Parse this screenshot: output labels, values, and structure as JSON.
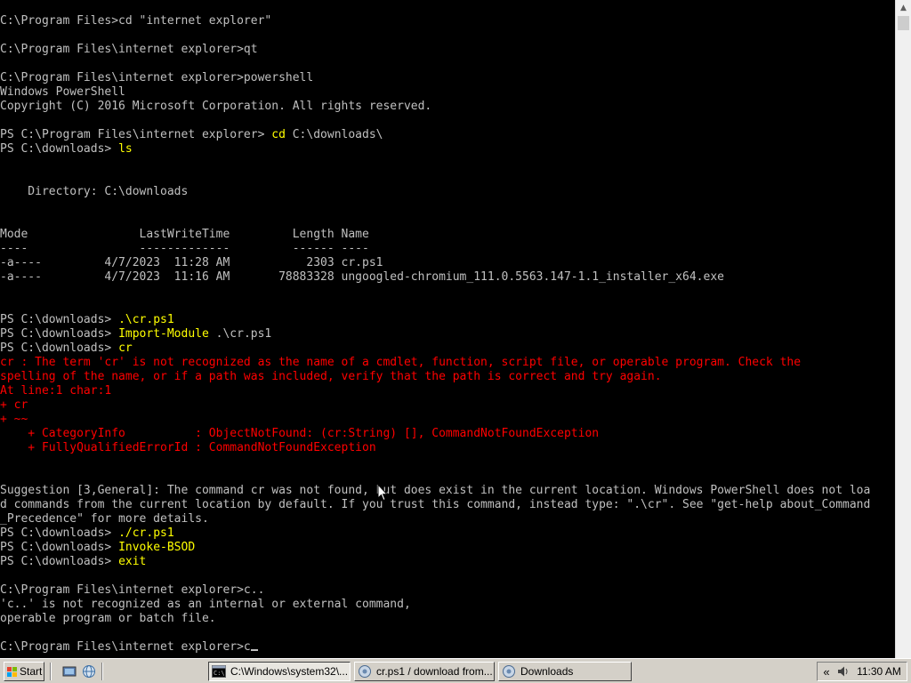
{
  "console": {
    "lines": [
      [
        {
          "t": "C:\\Program Files>cd \"internet explorer\""
        }
      ],
      [],
      [
        {
          "t": "C:\\Program Files\\internet explorer>qt"
        }
      ],
      [],
      [
        {
          "t": "C:\\Program Files\\internet explorer>powershell"
        }
      ],
      [
        {
          "t": "Windows PowerShell"
        }
      ],
      [
        {
          "t": "Copyright (C) 2016 Microsoft Corporation. All rights reserved."
        }
      ],
      [],
      [
        {
          "t": "PS C:\\Program Files\\internet explorer> "
        },
        {
          "t": "cd",
          "c": "y"
        },
        {
          "t": " C:\\downloads\\"
        }
      ],
      [
        {
          "t": "PS C:\\downloads> "
        },
        {
          "t": "ls",
          "c": "y"
        }
      ],
      [],
      [],
      [
        {
          "t": "    Directory: C:\\downloads"
        }
      ],
      [],
      [],
      [
        {
          "t": "Mode                LastWriteTime         Length Name"
        }
      ],
      [
        {
          "t": "----                -------------         ------ ----"
        }
      ],
      [
        {
          "t": "-a----         4/7/2023  11:28 AM           2303 cr.ps1"
        }
      ],
      [
        {
          "t": "-a----         4/7/2023  11:16 AM       78883328 ungoogled-chromium_111.0.5563.147-1.1_installer_x64.exe"
        }
      ],
      [],
      [],
      [
        {
          "t": "PS C:\\downloads> "
        },
        {
          "t": ".\\cr.ps1",
          "c": "y"
        }
      ],
      [
        {
          "t": "PS C:\\downloads> "
        },
        {
          "t": "Import-Module",
          "c": "y"
        },
        {
          "t": " .\\cr.ps1"
        }
      ],
      [
        {
          "t": "PS C:\\downloads> "
        },
        {
          "t": "cr",
          "c": "y"
        }
      ],
      [
        {
          "t": "cr : The term 'cr' is not recognized as the name of a cmdlet, function, script file, or operable program. Check the",
          "c": "r"
        }
      ],
      [
        {
          "t": "spelling of the name, or if a path was included, verify that the path is correct and try again.",
          "c": "r"
        }
      ],
      [
        {
          "t": "At line:1 char:1",
          "c": "r"
        }
      ],
      [
        {
          "t": "+ cr",
          "c": "r"
        }
      ],
      [
        {
          "t": "+ ~~",
          "c": "r"
        }
      ],
      [
        {
          "t": "    + CategoryInfo          : ObjectNotFound: (cr:String) [], CommandNotFoundException",
          "c": "r"
        }
      ],
      [
        {
          "t": "    + FullyQualifiedErrorId : CommandNotFoundException",
          "c": "r"
        }
      ],
      [],
      [],
      [
        {
          "t": "Suggestion [3,General]: The command cr was not found, but does exist in the current location. Windows PowerShell does not loa"
        }
      ],
      [
        {
          "t": "d commands from the current location by default. If you trust this command, instead type: \".\\cr\". See \"get-help about_Command"
        }
      ],
      [
        {
          "t": "_Precedence\" for more details."
        }
      ],
      [
        {
          "t": "PS C:\\downloads> "
        },
        {
          "t": "./cr.ps1",
          "c": "y"
        }
      ],
      [
        {
          "t": "PS C:\\downloads> "
        },
        {
          "t": "Invoke-BSOD",
          "c": "y"
        }
      ],
      [
        {
          "t": "PS C:\\downloads> "
        },
        {
          "t": "exit",
          "c": "y"
        }
      ],
      [],
      [
        {
          "t": "C:\\Program Files\\internet explorer>c.."
        }
      ],
      [
        {
          "t": "'c..' is not recognized as an internal or external command,"
        }
      ],
      [
        {
          "t": "operable program or batch file."
        }
      ],
      [],
      [
        {
          "t": "C:\\Program Files\\internet explorer>c"
        }
      ]
    ]
  },
  "taskbar": {
    "start_label": "Start",
    "tasks": [
      {
        "label": "C:\\Windows\\system32\\...",
        "icon": "cmd-icon"
      },
      {
        "label": "cr.ps1 / download from...",
        "icon": "browser-icon"
      },
      {
        "label": "Downloads",
        "icon": "folder-icon"
      }
    ],
    "tray": {
      "chevron": "«",
      "clock": "11:30 AM"
    }
  },
  "colors": {
    "console_bg": "#000000",
    "console_text": "#c0c0c0",
    "command_yellow": "#ffff00",
    "error_red": "#ff0000",
    "taskbar_bg": "#d4d0c8"
  }
}
